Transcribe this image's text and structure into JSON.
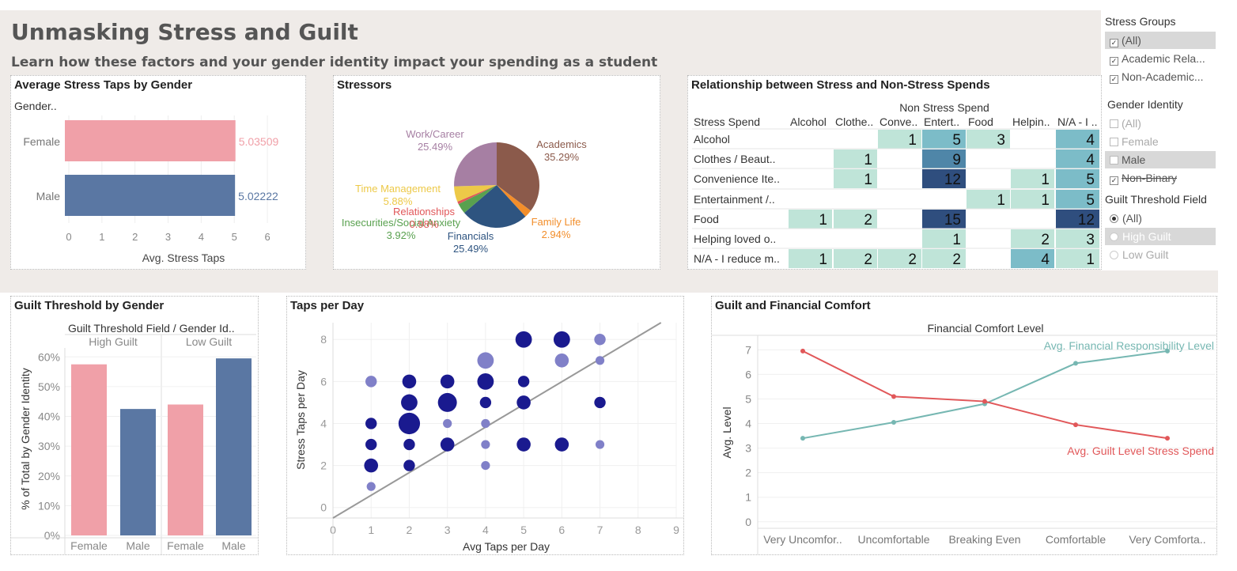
{
  "dashboard": {
    "title": "Unmasking Stress and Guilt",
    "subtitle": "Learn how these factors and your gender identity impact your spending as a student"
  },
  "filters": {
    "stress_groups": {
      "title": "Stress Groups",
      "items": [
        {
          "label": "(All)",
          "checked": true,
          "selected": true
        },
        {
          "label": "Academic Rela...",
          "checked": true,
          "selected": false
        },
        {
          "label": "Non-Academic...",
          "checked": true,
          "selected": false
        }
      ]
    },
    "gender_identity": {
      "title": "Gender Identity",
      "items": [
        {
          "label": "(All)",
          "checked": false,
          "selected": false
        },
        {
          "label": "Female",
          "checked": false,
          "selected": false
        },
        {
          "label": "Male",
          "checked": false,
          "selected": true
        },
        {
          "label": "Non-Binary",
          "checked": true,
          "selected": false
        }
      ]
    },
    "guilt_threshold": {
      "title": "Guilt Threshold Field",
      "items": [
        {
          "label": "(All)",
          "checked": true,
          "selected": false
        },
        {
          "label": "High Guilt",
          "checked": false,
          "selected": true
        },
        {
          "label": "Low Guilt",
          "checked": false,
          "selected": false
        }
      ]
    }
  },
  "panels": {
    "avg_stress_taps": "Average Stress Taps by Gender",
    "stressors": "Stressors",
    "relationship": "Relationship between Stress and Non-Stress Spends",
    "guilt_threshold": "Guilt Threshold by Gender",
    "taps_per_day": "Taps per Day",
    "guilt_financial": "Guilt and Financial Comfort"
  },
  "chart_data": [
    {
      "id": "avg_stress_taps",
      "type": "bar",
      "orientation": "horizontal",
      "title": "Average Stress Taps by Gender",
      "row_header": "Gender..",
      "categories": [
        "Female",
        "Male"
      ],
      "values": [
        5.03509,
        5.02222
      ],
      "value_labels": [
        "5.03509",
        "5.02222"
      ],
      "colors": [
        "#f0a0a8",
        "#5a77a3"
      ],
      "xlabel": "Avg. Stress Taps",
      "xlim": [
        0,
        6.5
      ],
      "xticks": [
        0,
        1,
        2,
        3,
        4,
        5,
        6
      ]
    },
    {
      "id": "stressors",
      "type": "pie",
      "title": "Stressors",
      "slices": [
        {
          "label": "Academics",
          "pct": "35.29%",
          "value": 35.29,
          "color": "#8b5a4b"
        },
        {
          "label": "Family Life",
          "pct": "2.94%",
          "value": 2.94,
          "color": "#f28e2b"
        },
        {
          "label": "Financials",
          "pct": "25.49%",
          "value": 25.49,
          "color": "#2e5480"
        },
        {
          "label": "Insecurities/Social Anxiety",
          "pct": "3.92%",
          "value": 3.92,
          "color": "#59a14f"
        },
        {
          "label": "Relationships",
          "pct": "0.98%",
          "value": 0.98,
          "color": "#e15759"
        },
        {
          "label": "Time Management",
          "pct": "5.88%",
          "value": 5.88,
          "color": "#edc948"
        },
        {
          "label": "Work/Career",
          "pct": "25.49%",
          "value": 25.49,
          "color": "#a67fa3"
        }
      ]
    },
    {
      "id": "relationship",
      "type": "heatmap",
      "title": "Relationship between Stress and Non-Stress Spends",
      "column_group": "Non Stress Spend",
      "row_header": "Stress Spend",
      "columns": [
        "Alcohol",
        "Clothe..",
        "Conve..",
        "Entert..",
        "Food",
        "Helpin..",
        "N/A - I .."
      ],
      "rows": [
        "Alcohol",
        "Clothes / Beaut..",
        "Convenience Ite..",
        "Entertainment /..",
        "Food",
        "Helping loved o..",
        "N/A - I reduce m.."
      ],
      "values": [
        [
          null,
          null,
          1,
          5,
          3,
          null,
          4
        ],
        [
          null,
          1,
          null,
          9,
          null,
          null,
          4
        ],
        [
          null,
          1,
          null,
          12,
          null,
          1,
          5
        ],
        [
          null,
          null,
          null,
          null,
          1,
          1,
          5
        ],
        [
          1,
          2,
          null,
          15,
          null,
          null,
          12
        ],
        [
          null,
          null,
          null,
          1,
          null,
          2,
          3
        ],
        [
          1,
          2,
          2,
          2,
          null,
          4,
          1
        ]
      ]
    },
    {
      "id": "guilt_threshold",
      "type": "bar",
      "title": "Guilt Threshold by Gender",
      "header": "Guilt Threshold Field  /  Gender Id..",
      "groups": [
        "High Guilt",
        "Low Guilt"
      ],
      "categories": [
        "Female",
        "Male",
        "Female",
        "Male"
      ],
      "group_of": [
        0,
        0,
        1,
        1
      ],
      "values": [
        57.5,
        42.5,
        44,
        59.5
      ],
      "colors": [
        "#f0a0a8",
        "#5a77a3",
        "#f0a0a8",
        "#5a77a3"
      ],
      "ylabel": "% of Total by Gender Identity",
      "ylim": [
        0,
        63
      ],
      "yticks": [
        "0%",
        "10%",
        "20%",
        "30%",
        "40%",
        "50%",
        "60%"
      ],
      "ytick_values": [
        0,
        10,
        20,
        30,
        40,
        50,
        60
      ]
    },
    {
      "id": "taps_per_day",
      "type": "scatter",
      "title": "Taps per Day",
      "xlabel": "Avg Taps per Day",
      "ylabel": "Stress Taps per Day",
      "xlim": [
        0,
        9
      ],
      "ylim": [
        -0.5,
        8.8
      ],
      "xticks": [
        0,
        1,
        2,
        3,
        4,
        5,
        6,
        7,
        8,
        9
      ],
      "yticks": [
        0,
        2,
        4,
        6,
        8
      ],
      "trend": [
        [
          0,
          -0.5
        ],
        [
          8.6,
          8.8
        ]
      ],
      "points": [
        {
          "x": 1,
          "y": 6,
          "size": 2,
          "light": true
        },
        {
          "x": 1,
          "y": 4,
          "size": 2,
          "light": false
        },
        {
          "x": 1,
          "y": 3,
          "size": 2,
          "light": false
        },
        {
          "x": 1,
          "y": 2,
          "size": 3,
          "light": false
        },
        {
          "x": 1,
          "y": 1,
          "size": 1,
          "light": true
        },
        {
          "x": 2,
          "y": 6,
          "size": 3,
          "light": false
        },
        {
          "x": 2,
          "y": 5,
          "size": 4,
          "light": false
        },
        {
          "x": 2,
          "y": 4,
          "size": 6,
          "light": false
        },
        {
          "x": 2,
          "y": 3,
          "size": 2,
          "light": false
        },
        {
          "x": 2,
          "y": 2,
          "size": 2,
          "light": false
        },
        {
          "x": 3,
          "y": 6,
          "size": 3,
          "light": false
        },
        {
          "x": 3,
          "y": 5,
          "size": 5,
          "light": false
        },
        {
          "x": 3,
          "y": 4,
          "size": 1,
          "light": true
        },
        {
          "x": 3,
          "y": 3,
          "size": 3,
          "light": false
        },
        {
          "x": 4,
          "y": 7,
          "size": 4,
          "light": true
        },
        {
          "x": 4,
          "y": 6,
          "size": 4,
          "light": false
        },
        {
          "x": 4,
          "y": 5,
          "size": 2,
          "light": false
        },
        {
          "x": 4,
          "y": 4,
          "size": 1,
          "light": true
        },
        {
          "x": 4,
          "y": 3,
          "size": 1,
          "light": true
        },
        {
          "x": 4,
          "y": 2,
          "size": 1,
          "light": true
        },
        {
          "x": 5,
          "y": 8,
          "size": 4,
          "light": false
        },
        {
          "x": 5,
          "y": 6,
          "size": 2,
          "light": false
        },
        {
          "x": 5,
          "y": 5,
          "size": 3,
          "light": false
        },
        {
          "x": 5,
          "y": 3,
          "size": 3,
          "light": false
        },
        {
          "x": 6,
          "y": 8,
          "size": 4,
          "light": false
        },
        {
          "x": 6,
          "y": 7,
          "size": 3,
          "light": true
        },
        {
          "x": 6,
          "y": 3,
          "size": 3,
          "light": false
        },
        {
          "x": 7,
          "y": 8,
          "size": 2,
          "light": true
        },
        {
          "x": 7,
          "y": 7,
          "size": 1,
          "light": true
        },
        {
          "x": 7,
          "y": 5,
          "size": 2,
          "light": false
        },
        {
          "x": 7,
          "y": 3,
          "size": 1,
          "light": true
        }
      ]
    },
    {
      "id": "guilt_financial",
      "type": "line",
      "title": "Guilt and Financial Comfort",
      "xlabel": "Financial Comfort Level",
      "ylabel": "Avg. Level",
      "categories": [
        "Very Uncomfor..",
        "Uncomfortable",
        "Breaking Even",
        "Comfortable",
        "Very Comforta.."
      ],
      "ylim": [
        -0.2,
        7.3
      ],
      "yticks": [
        0,
        1,
        2,
        3,
        4,
        5,
        6,
        7
      ],
      "series": [
        {
          "name": "Avg. Financial Responsibility Level",
          "values": [
            3.4,
            4.05,
            4.8,
            6.45,
            6.95
          ],
          "color": "#76b7b2"
        },
        {
          "name": "Avg. Guilt Level Stress Spend",
          "values": [
            6.95,
            5.1,
            4.9,
            3.95,
            3.4
          ],
          "color": "#e15759"
        }
      ]
    }
  ]
}
